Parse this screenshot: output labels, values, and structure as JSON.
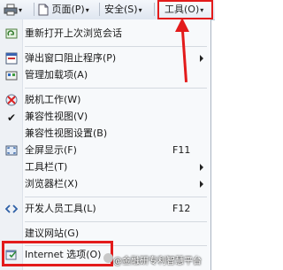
{
  "toolbar": {
    "print_arrow": "▾",
    "page_label": "页面",
    "page_key": "(P)",
    "safety_label": "安全",
    "safety_key": "(S)",
    "tools_label": "工具",
    "tools_key": "(O)",
    "drop_arrow": "▾"
  },
  "menu": {
    "items": [
      {
        "label": "重新打开上次浏览会话",
        "icon": "reopen-session-icon"
      },
      {
        "label": "弹出窗口阻止程序",
        "key": "(P)",
        "icon": "popup-blocker-icon"
      },
      {
        "label": "管理加载项",
        "key": "(A)",
        "icon": "addons-icon"
      },
      {
        "label": "脱机工作",
        "key": "(W)",
        "icon": "offline-icon"
      },
      {
        "label": "兼容性视图",
        "key": "(V)",
        "checked": "✔"
      },
      {
        "label": "兼容性视图设置",
        "key": "(B)"
      },
      {
        "label": "全屏显示",
        "key": "(F)",
        "shortcut": "F11",
        "icon": "fullscreen-icon"
      },
      {
        "label": "工具栏",
        "key": "(T)"
      },
      {
        "label": "浏览器栏",
        "key": "(X)"
      },
      {
        "label": "开发人员工具",
        "key": "(L)",
        "shortcut": "F12",
        "icon": "developer-tools-icon"
      },
      {
        "label": "建议网站",
        "key": "(G)"
      },
      {
        "label": "Internet 选项",
        "key": "(O)",
        "icon": "internet-options-icon"
      }
    ]
  },
  "watermark": "@金融研专利智慧平台",
  "colors": {
    "highlight": "#e31b1b",
    "menu_bg": "#f7f9fb",
    "toolbar_bg": "#dfe6f0"
  }
}
